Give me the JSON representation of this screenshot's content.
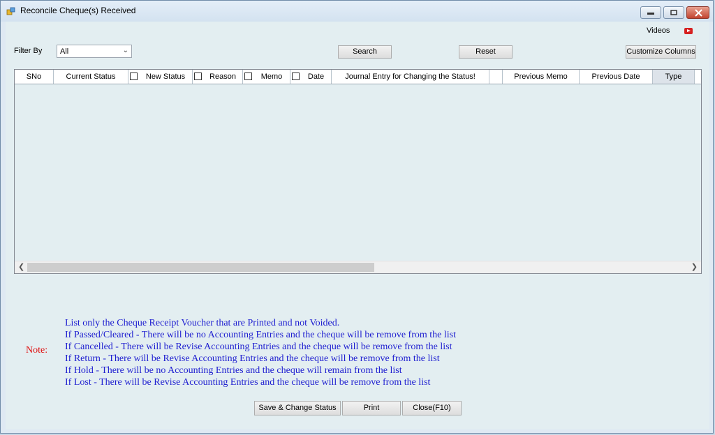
{
  "window": {
    "title": "Reconcile Cheque(s) Received",
    "icon": "app-window-icon"
  },
  "header": {
    "videos_label": "Videos",
    "videos_icon": "youtube-play-icon"
  },
  "filter": {
    "label": "Filter By",
    "value": "All"
  },
  "toolbar": {
    "search_label": "Search",
    "reset_label": "Reset",
    "customize_label": "Customize Columns"
  },
  "grid": {
    "columns": [
      "SNo",
      "Current Status",
      "New Status",
      "Reason",
      "Memo",
      "Date",
      "Journal Entry for Changing the Status!",
      "",
      "Previous Memo",
      "Previous Date",
      "Type"
    ],
    "rows": []
  },
  "notes": {
    "label": "Note:",
    "lines": [
      "List only the Cheque Receipt Voucher that are Printed and not Voided.",
      "If Passed/Cleared - There will be no Accounting Entries and the cheque will be remove from the list",
      "If Cancelled - There will be Revise Accounting Entries and the cheque will be remove from the list",
      "If Return - There will be Revise Accounting Entries and the cheque will be remove from the list",
      "If Hold - There will be no Accounting Entries and the cheque will remain from the list",
      "If Lost - There will be Revise Accounting Entries and the cheque will be remove from the list"
    ]
  },
  "footer": {
    "save_label": "Save & Change Status",
    "print_label": "Print",
    "close_label": "Close(F10)"
  },
  "colors": {
    "note_label": "#e01010",
    "note_text": "#1e1ed0",
    "client_bg": "#e3eef1"
  }
}
